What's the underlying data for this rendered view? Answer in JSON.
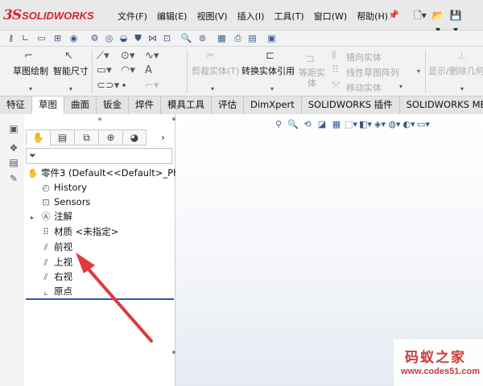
{
  "app": {
    "brand_ds": "3S",
    "brand_name": "SOLIDWORKS"
  },
  "menu": [
    "文件(F)",
    "编辑(E)",
    "视图(V)",
    "插入(I)",
    "工具(T)",
    "窗口(W)",
    "帮助(H)"
  ],
  "commands": {
    "sketch": "草图绘制",
    "smart_dim": "智能尺寸",
    "trim": "剪裁实体(T)",
    "convert": "转换实体引用",
    "offset": "等距实\n体",
    "mirror": "镜向实体",
    "linear_pattern": "线性草图阵列",
    "move": "移动实体",
    "show_hide": "显示/删除几何"
  },
  "tabs": [
    "特征",
    "草图",
    "曲面",
    "钣金",
    "焊件",
    "模具工具",
    "评估",
    "DimXpert",
    "SOLIDWORKS 插件",
    "SOLIDWORKS MBD"
  ],
  "active_tab": "草图",
  "tree": {
    "root": "零件3  (Default<<Default>_Ph",
    "items": [
      {
        "label": "History",
        "icon": "history-icon"
      },
      {
        "label": "Sensors",
        "icon": "sensors-icon"
      },
      {
        "label": "注解",
        "icon": "annotations-icon"
      },
      {
        "label": "材质 <未指定>",
        "icon": "material-icon"
      },
      {
        "label": "前视",
        "icon": "plane-icon"
      },
      {
        "label": "上视",
        "icon": "plane-icon"
      },
      {
        "label": "右视",
        "icon": "plane-icon"
      },
      {
        "label": "原点",
        "icon": "origin-icon"
      }
    ]
  },
  "watermark": {
    "title": "码蚁之家",
    "url": "www.codes51.com"
  },
  "colors": {
    "brand": "#d8232a",
    "accent": "#2b5aa8",
    "arrow": "#e03a3a"
  }
}
